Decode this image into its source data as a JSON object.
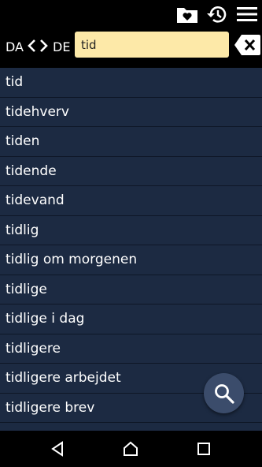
{
  "header": {
    "icons": [
      "favorites-folder-icon",
      "history-icon",
      "menu-icon"
    ],
    "lang_from": "DA",
    "lang_to": "DE"
  },
  "search": {
    "value": "tid"
  },
  "results": [
    "tid",
    "tidehverv",
    "tiden",
    "tidende",
    "tidevand",
    "tidlig",
    "tidlig om morgenen",
    "tidlige",
    "tidlige i dag",
    "tidligere",
    "tidligere arbejdet",
    "tidligere brev"
  ],
  "fab": {
    "icon": "search-icon"
  },
  "navbar": {
    "icons": [
      "back-icon",
      "home-icon",
      "recents-icon"
    ]
  },
  "colors": {
    "background": "#1c2a42",
    "topbar": "#000000",
    "search_field": "#fde9a8",
    "fab": "#3b4c6b"
  }
}
